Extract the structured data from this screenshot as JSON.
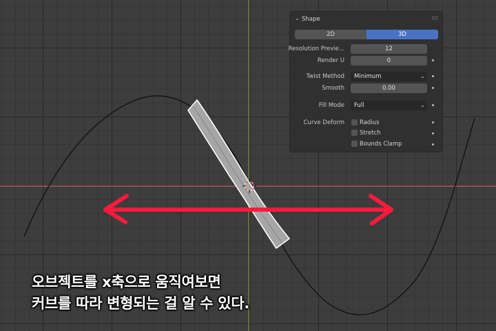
{
  "panel": {
    "title": "Shape",
    "segments": {
      "option_2d": "2D",
      "option_3d": "3D",
      "selected": "3D"
    },
    "resolution_preview": {
      "label": "Resolution Previe...",
      "value": "12"
    },
    "render_u": {
      "label": "Render U",
      "value": "0"
    },
    "twist_method": {
      "label": "Twist Method",
      "value": "Minimum"
    },
    "smooth": {
      "label": "Smooth",
      "value": "0.00"
    },
    "fill_mode": {
      "label": "Fill Mode",
      "value": "Full"
    },
    "curve_deform": {
      "label": "Curve Deform",
      "radius": {
        "label": "Radius",
        "checked": false
      },
      "stretch": {
        "label": "Stretch",
        "checked": false
      },
      "bounds_clamp": {
        "label": "Bounds Clamp",
        "checked": false
      }
    }
  },
  "caption": {
    "line1": "오브젝트를 x축으로 움직여보면",
    "line2": "커브를 따라 변형되는 걸 알 수 있다."
  },
  "colors": {
    "viewport_bg": "#3d3d3d",
    "x_axis": "#c9606a",
    "y_axis": "#7d9a2e",
    "arrow": "#ff1a3c",
    "accent_selected": "#4a72c4",
    "object_fill": "#a6a6a6",
    "object_outline": "#ffffff"
  }
}
